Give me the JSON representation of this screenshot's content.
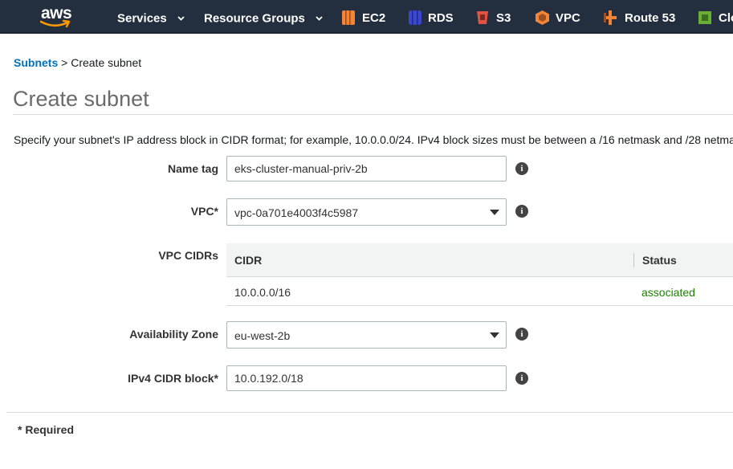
{
  "nav": {
    "logo_text": "aws",
    "services_label": "Services",
    "resource_groups_label": "Resource Groups",
    "shortcuts": [
      {
        "label": "EC2",
        "icon": "ec2-icon",
        "color": "#f58534"
      },
      {
        "label": "RDS",
        "icon": "rds-icon",
        "color": "#3b48cc"
      },
      {
        "label": "S3",
        "icon": "s3-icon",
        "color": "#e05243"
      },
      {
        "label": "VPC",
        "icon": "vpc-icon",
        "color": "#f58534"
      },
      {
        "label": "Route 53",
        "icon": "route53-icon",
        "color": "#f58534"
      },
      {
        "label": "Clo",
        "icon": "cloud-icon",
        "color": "#6aaf35"
      }
    ]
  },
  "breadcrumb": {
    "parent": "Subnets",
    "separator": ">",
    "current": "Create subnet"
  },
  "page": {
    "title": "Create subnet",
    "description": "Specify your subnet's IP address block in CIDR format; for example, 10.0.0.0/24. IPv4 block sizes must be between a /16 netmask and /28 netma"
  },
  "form": {
    "name_tag": {
      "label": "Name tag",
      "value": "eks-cluster-manual-priv-2b"
    },
    "vpc": {
      "label": "VPC*",
      "value": "vpc-0a701e4003f4c5987"
    },
    "vpc_cidrs": {
      "label": "VPC CIDRs",
      "columns": [
        "CIDR",
        "Status"
      ],
      "rows": [
        {
          "cidr": "10.0.0.0/16",
          "status": "associated"
        }
      ]
    },
    "availability_zone": {
      "label": "Availability Zone",
      "value": "eu-west-2b"
    },
    "ipv4_cidr": {
      "label": "IPv4 CIDR block*",
      "value": "10.0.192.0/18"
    },
    "info_glyph": "i"
  },
  "footer": {
    "required_note": "* Required"
  },
  "colors": {
    "nav_bg": "#232f3e",
    "link": "#0073bb",
    "status_ok": "#1d8102",
    "aws_orange": "#ff9900"
  }
}
